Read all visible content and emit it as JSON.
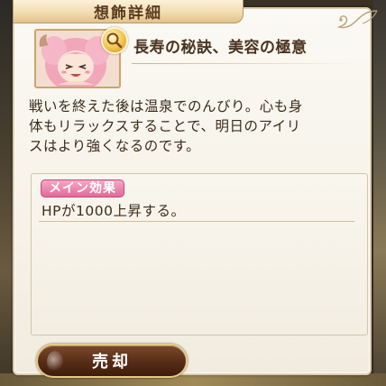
{
  "header": {
    "title": "想飾詳細"
  },
  "item": {
    "name": "長寿の秘訣、美容の極意",
    "description": "戦いを終えた後は温泉でのんびり。心も身\n体もリラックスすることで、明日のアイリ\nスはより強くなるのです。",
    "portrait_icon": "character-portrait",
    "detail_icon": "magnifier-icon"
  },
  "effect": {
    "badge_label": "メイン効果",
    "text": "HPが1000上昇する。"
  },
  "actions": {
    "sell_label": "売却"
  },
  "colors": {
    "badge_pink": "#e26a98",
    "button_brown": "#5a2e18",
    "text_dark": "#3c2c1c"
  }
}
